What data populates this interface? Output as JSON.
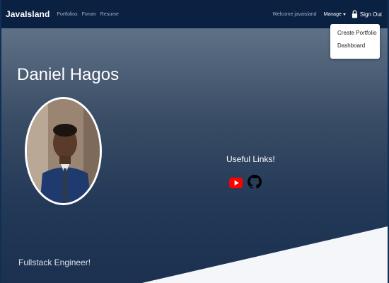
{
  "navbar": {
    "brand": "JavaIsland",
    "links": [
      "Portfolios",
      "Forum",
      "Resume"
    ],
    "welcome": "Welcome javaisland",
    "manage_label": "Manage",
    "signout_label": "Sign Out",
    "icons": {
      "signout": "lock-icon",
      "manage": "caret-down-icon"
    }
  },
  "dropdown": {
    "items": [
      "Create Portfolio",
      "Dashboard"
    ]
  },
  "hero": {
    "title": "Daniel Hagos",
    "subtitle": "Fullstack Engineer!",
    "useful_links_label": "Useful Links!",
    "link_icons": [
      "youtube-icon",
      "github-icon"
    ]
  },
  "colors": {
    "navbar_bg": "#0b2142",
    "hero_top": "#5f7186",
    "hero_bottom": "#1c3150",
    "youtube_red": "#ff0000"
  }
}
